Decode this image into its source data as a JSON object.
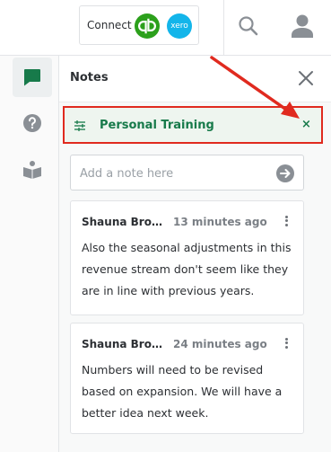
{
  "header": {
    "connect_label": "Connect",
    "qb_icon": "quickbooks-logo",
    "xero_label": "xero",
    "search_icon": "search-icon",
    "user_icon": "user-avatar-icon"
  },
  "rail": {
    "items": [
      {
        "icon": "chat-bubble-icon",
        "active": true
      },
      {
        "icon": "help-circle-icon",
        "active": false
      },
      {
        "icon": "open-book-icon",
        "active": false
      }
    ]
  },
  "notes_panel": {
    "title": "Notes",
    "filter": {
      "label": "Personal Training",
      "clear_symbol": "×"
    },
    "input": {
      "placeholder": "Add a note here",
      "value": ""
    },
    "notes": [
      {
        "author": "Shauna Brooks",
        "time": "13 minutes ago",
        "body": "Also the seasonal adjustments in this revenue stream don't seem like they are in line with previous years."
      },
      {
        "author": "Shauna Brooks",
        "time": "24 minutes ago",
        "body": "Numbers will need to be revised based on expansion. We will have a better idea next week."
      }
    ]
  },
  "colors": {
    "accent_green": "#177a4a",
    "highlight_red": "#e02a1f",
    "quickbooks_green": "#2ca01c",
    "xero_blue": "#13b5ea"
  }
}
